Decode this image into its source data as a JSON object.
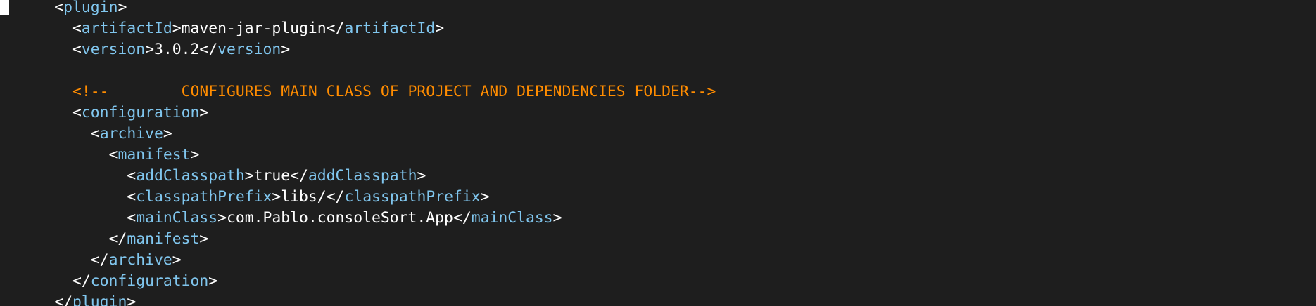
{
  "colors": {
    "background": "#1e1e1e",
    "tag_name": "#80c6ee",
    "bracket": "#ffffff",
    "text": "#ffffff",
    "comment": "#ff8c00",
    "cursor": "#ffffff"
  },
  "code": {
    "lines": [
      {
        "indent": "      ",
        "open": "<",
        "tag": "plugin",
        "close": ">"
      },
      {
        "indent": "        ",
        "open": "<",
        "tag": "artifactId",
        "close": ">",
        "text": "maven-jar-plugin",
        "end_open": "</",
        "end_tag": "artifactId",
        "end_close": ">"
      },
      {
        "indent": "        ",
        "open": "<",
        "tag": "version",
        "close": ">",
        "text": "3.0.2",
        "end_open": "</",
        "end_tag": "version",
        "end_close": ">"
      },
      {
        "indent": "",
        "text": ""
      },
      {
        "indent": "        ",
        "comment": "<!--        CONFIGURES MAIN CLASS OF PROJECT AND DEPENDENCIES FOLDER-->"
      },
      {
        "indent": "        ",
        "open": "<",
        "tag": "configuration",
        "close": ">"
      },
      {
        "indent": "          ",
        "open": "<",
        "tag": "archive",
        "close": ">"
      },
      {
        "indent": "            ",
        "open": "<",
        "tag": "manifest",
        "close": ">"
      },
      {
        "indent": "              ",
        "open": "<",
        "tag": "addClasspath",
        "close": ">",
        "text": "true",
        "end_open": "</",
        "end_tag": "addClasspath",
        "end_close": ">"
      },
      {
        "indent": "              ",
        "open": "<",
        "tag": "classpathPrefix",
        "close": ">",
        "text": "libs/",
        "end_open": "</",
        "end_tag": "classpathPrefix",
        "end_close": ">"
      },
      {
        "indent": "              ",
        "open": "<",
        "tag": "mainClass",
        "close": ">",
        "text": "com.Pablo.consoleSort.App",
        "end_open": "</",
        "end_tag": "mainClass",
        "end_close": ">"
      },
      {
        "indent": "            ",
        "open": "</",
        "tag": "manifest",
        "close": ">"
      },
      {
        "indent": "          ",
        "open": "</",
        "tag": "archive",
        "close": ">"
      },
      {
        "indent": "        ",
        "open": "</",
        "tag": "configuration",
        "close": ">"
      },
      {
        "indent": "      ",
        "open": "</",
        "tag": "plugin",
        "close": ">"
      }
    ]
  }
}
